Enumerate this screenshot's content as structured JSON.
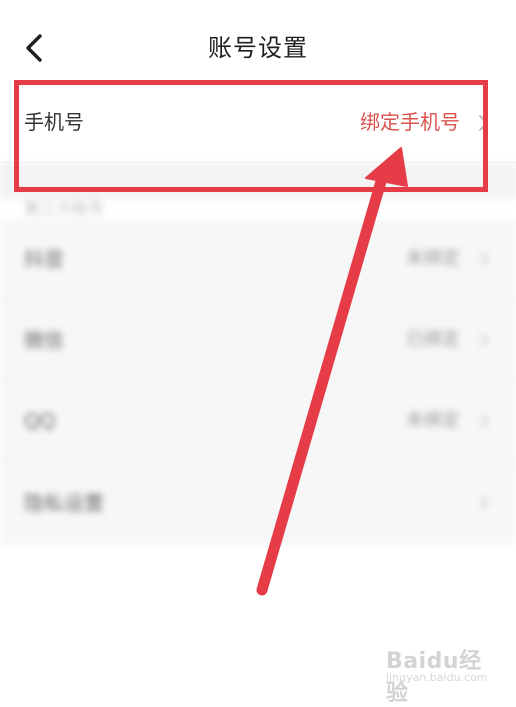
{
  "header": {
    "title": "账号设置",
    "back_icon": "chevron-left-icon"
  },
  "phone_row": {
    "label": "手机号",
    "value": "绑定手机号",
    "value_color": "#d9544f"
  },
  "blurred_section": {
    "group_header": "第三方账号",
    "rows": [
      {
        "label": "抖音",
        "value": "未绑定"
      },
      {
        "label": "微信",
        "value": "已绑定"
      },
      {
        "label": "QQ",
        "value": "未绑定"
      },
      {
        "label": "隐私设置",
        "value": ""
      }
    ]
  },
  "annotation": {
    "color": "#e53c48"
  },
  "watermark": {
    "brand": "Baidu经验",
    "url": "jingyan.baidu.com"
  }
}
